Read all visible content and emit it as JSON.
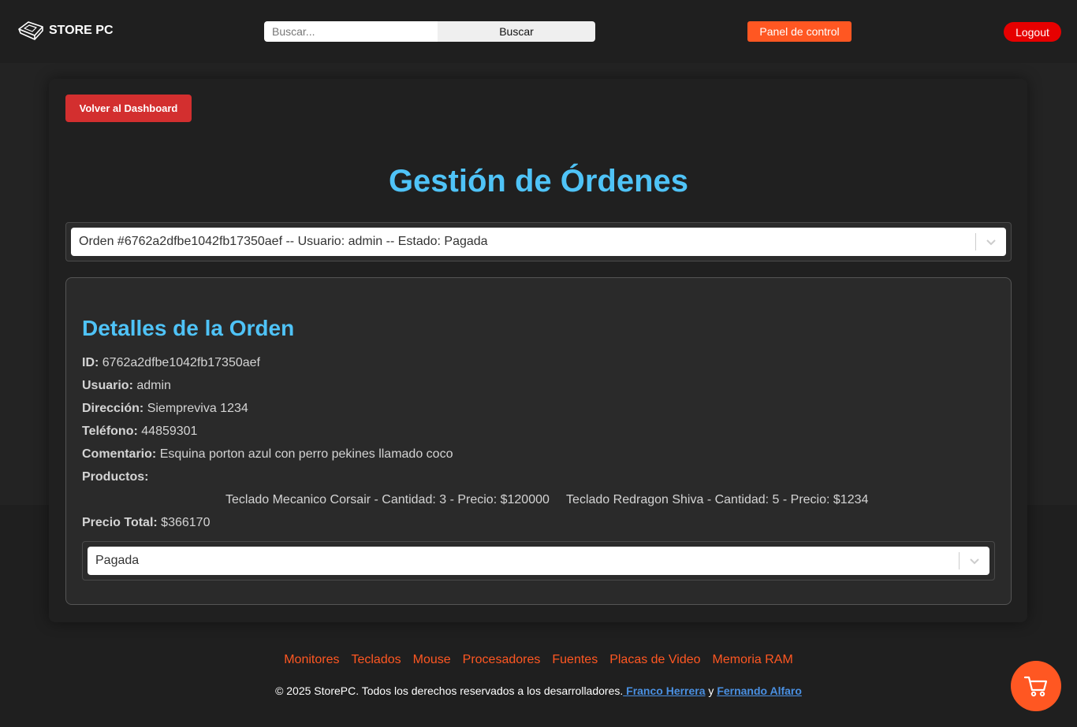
{
  "header": {
    "brand": "STORE PC",
    "search": {
      "placeholder": "Buscar...",
      "value": "",
      "button_label": "Buscar"
    },
    "panel_label": "Panel de control",
    "logout_label": "Logout"
  },
  "main": {
    "back_label": "Volver al Dashboard",
    "title": "Gestión de Órdenes",
    "order_select": {
      "selected": "Orden #6762a2dfbe1042fb17350aef -- Usuario: admin -- Estado: Pagada"
    },
    "details": {
      "title": "Detalles de la Orden",
      "id_label": "ID:",
      "id_value": "6762a2dfbe1042fb17350aef",
      "user_label": "Usuario:",
      "user_value": "admin",
      "address_label": "Dirección:",
      "address_value": "Siempreviva 1234",
      "phone_label": "Teléfono:",
      "phone_value": "44859301",
      "comment_label": "Comentario:",
      "comment_value": "Esquina porton azul con perro pekines llamado coco",
      "products_label": "Productos:",
      "products": [
        "Teclado Mecanico Corsair - Cantidad: 3 - Precio: $120000",
        "Teclado Redragon Shiva - Cantidad: 5 - Precio: $1234"
      ],
      "total_label": "Precio Total:",
      "total_value": "$366170",
      "status_select": {
        "selected": "Pagada"
      }
    }
  },
  "footer": {
    "links": [
      "Monitores",
      "Teclados",
      "Mouse",
      "Procesadores",
      "Fuentes",
      "Placas de Video",
      "Memoria RAM"
    ],
    "copyright_text": "© 2025 StorePC. Todos los derechos reservados a los desarrolladores.",
    "author1": " Franco Herrera",
    "conj": "y",
    "author2": "Fernando Alfaro"
  },
  "colors": {
    "accent_orange": "#ff5722",
    "title_blue": "#4fc3f7",
    "danger_red": "#d32f2f",
    "logout_red": "#e60000",
    "link_blue": "#4a90e2"
  },
  "icons": {
    "brand": "keycap-icon",
    "cart": "shopping-cart-icon"
  }
}
